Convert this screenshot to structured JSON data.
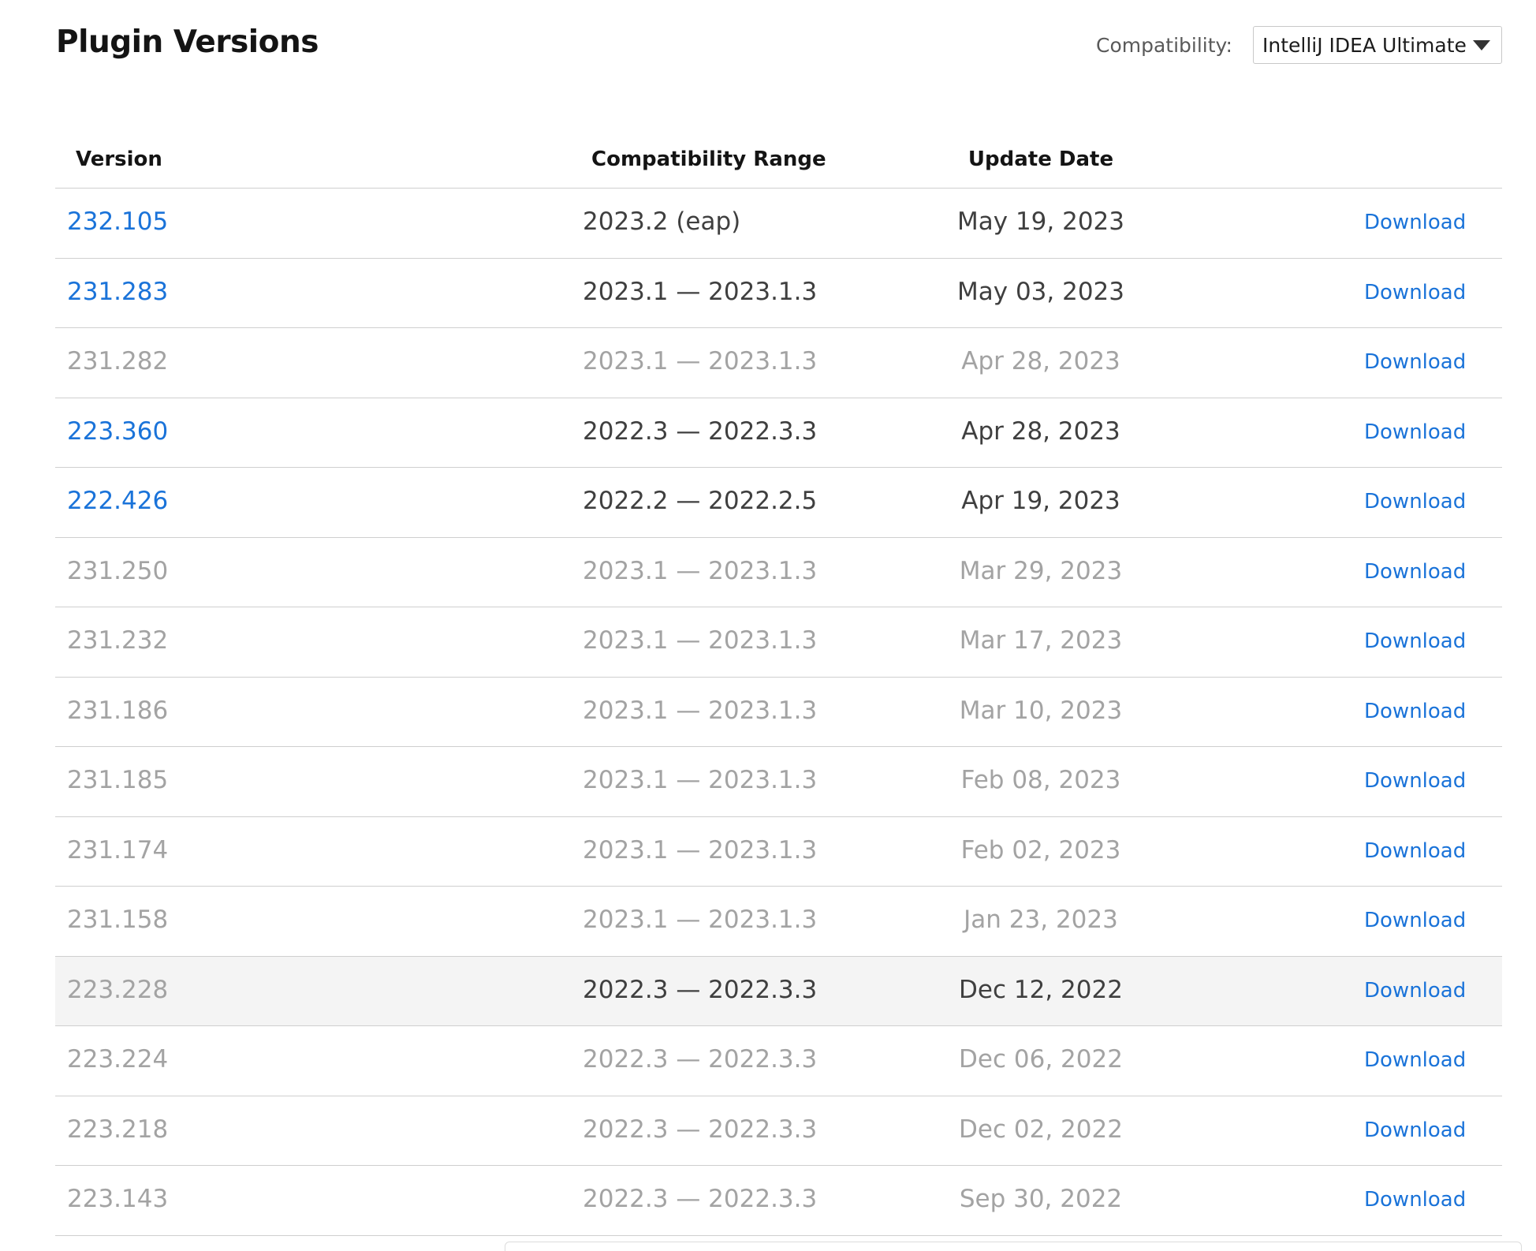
{
  "page": {
    "title": "Plugin Versions"
  },
  "compatibility": {
    "label": "Compatibility:",
    "selected": "IntelliJ IDEA Ultimate"
  },
  "table": {
    "columns": [
      "Version",
      "Compatibility Range",
      "Update Date"
    ],
    "download_label": "Download",
    "rows": [
      {
        "version": "232.105",
        "range": "2023.2 (eap)",
        "date": "May 19, 2023",
        "state": "active"
      },
      {
        "version": "231.283",
        "range": "2023.1 — 2023.1.3",
        "date": "May 03, 2023",
        "state": "active"
      },
      {
        "version": "231.282",
        "range": "2023.1 — 2023.1.3",
        "date": "Apr 28, 2023",
        "state": "muted"
      },
      {
        "version": "223.360",
        "range": "2022.3 — 2022.3.3",
        "date": "Apr 28, 2023",
        "state": "active"
      },
      {
        "version": "222.426",
        "range": "2022.2 — 2022.2.5",
        "date": "Apr 19, 2023",
        "state": "active"
      },
      {
        "version": "231.250",
        "range": "2023.1 — 2023.1.3",
        "date": "Mar 29, 2023",
        "state": "muted"
      },
      {
        "version": "231.232",
        "range": "2023.1 — 2023.1.3",
        "date": "Mar 17, 2023",
        "state": "muted"
      },
      {
        "version": "231.186",
        "range": "2023.1 — 2023.1.3",
        "date": "Mar 10, 2023",
        "state": "muted"
      },
      {
        "version": "231.185",
        "range": "2023.1 — 2023.1.3",
        "date": "Feb 08, 2023",
        "state": "muted"
      },
      {
        "version": "231.174",
        "range": "2023.1 — 2023.1.3",
        "date": "Feb 02, 2023",
        "state": "muted"
      },
      {
        "version": "231.158",
        "range": "2023.1 — 2023.1.3",
        "date": "Jan 23, 2023",
        "state": "muted"
      },
      {
        "version": "223.228",
        "range": "2022.3 — 2022.3.3",
        "date": "Dec 12, 2022",
        "state": "hover"
      },
      {
        "version": "223.224",
        "range": "2022.3 — 2022.3.3",
        "date": "Dec 06, 2022",
        "state": "muted"
      },
      {
        "version": "223.218",
        "range": "2022.3 — 2022.3.3",
        "date": "Dec 02, 2022",
        "state": "muted"
      },
      {
        "version": "223.143",
        "range": "2022.3 — 2022.3.3",
        "date": "Sep 30, 2022",
        "state": "muted"
      }
    ]
  },
  "colors": {
    "link": "#1a73d9",
    "muted_text": "#a3a3a3",
    "active_text": "#3f3f3f",
    "hover_row_bg": "#f4f4f4",
    "divider": "#cfcfcf"
  },
  "icons": {
    "dropdown": "chevron-down-icon"
  }
}
